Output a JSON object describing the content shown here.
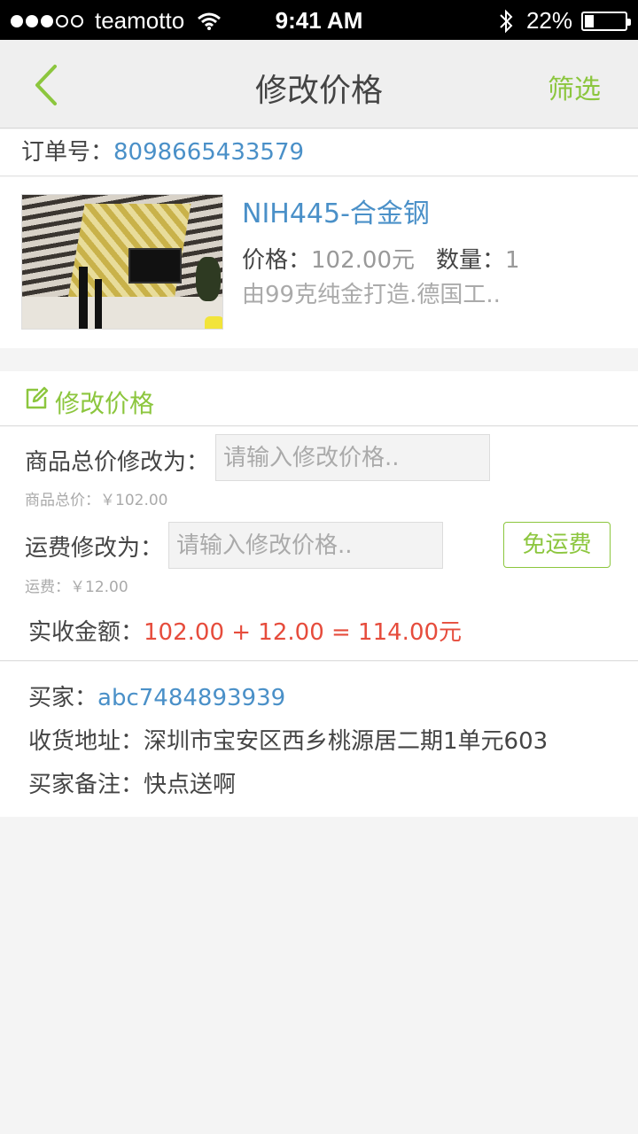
{
  "status_bar": {
    "carrier": "teamotto",
    "time": "9:41 AM",
    "battery_percent": "22%",
    "battery_level": 0.22,
    "signal_dots_filled": 3,
    "signal_dots_total": 5
  },
  "nav": {
    "title": "修改价格",
    "filter_label": "筛选",
    "back_icon": "chevron-left-icon"
  },
  "order": {
    "label": "订单号：",
    "number": "8098665433579"
  },
  "product": {
    "name": "NIH445-合金钢",
    "price_label": "价格：",
    "price_value": "102.00元",
    "qty_label": "数量：",
    "qty_value": "1",
    "description": "由99克纯金打造.德国工.."
  },
  "modify": {
    "section_title": "修改价格",
    "total_label": "商品总价修改为：",
    "total_placeholder": "请输入修改价格..",
    "total_hint": "商品总价：￥102.00",
    "shipping_label": "运费修改为：",
    "shipping_placeholder": "请输入修改价格..",
    "shipping_hint": "运费：￥12.00",
    "free_shipping_button": "免运费",
    "amount_label": "实收金额：",
    "amount_value": "102.00 + 12.00 = 114.00元"
  },
  "buyer": {
    "buyer_label": "买家：",
    "buyer_value": "abc7484893939",
    "address_label": "收货地址：",
    "address_value": "深圳市宝安区西乡桃源居二期1单元603",
    "note_label": "买家备注：",
    "note_value": "快点送啊"
  },
  "colors": {
    "accent_green": "#8cc63e",
    "link_blue": "#4a90c8",
    "amount_red": "#e64c3c"
  }
}
